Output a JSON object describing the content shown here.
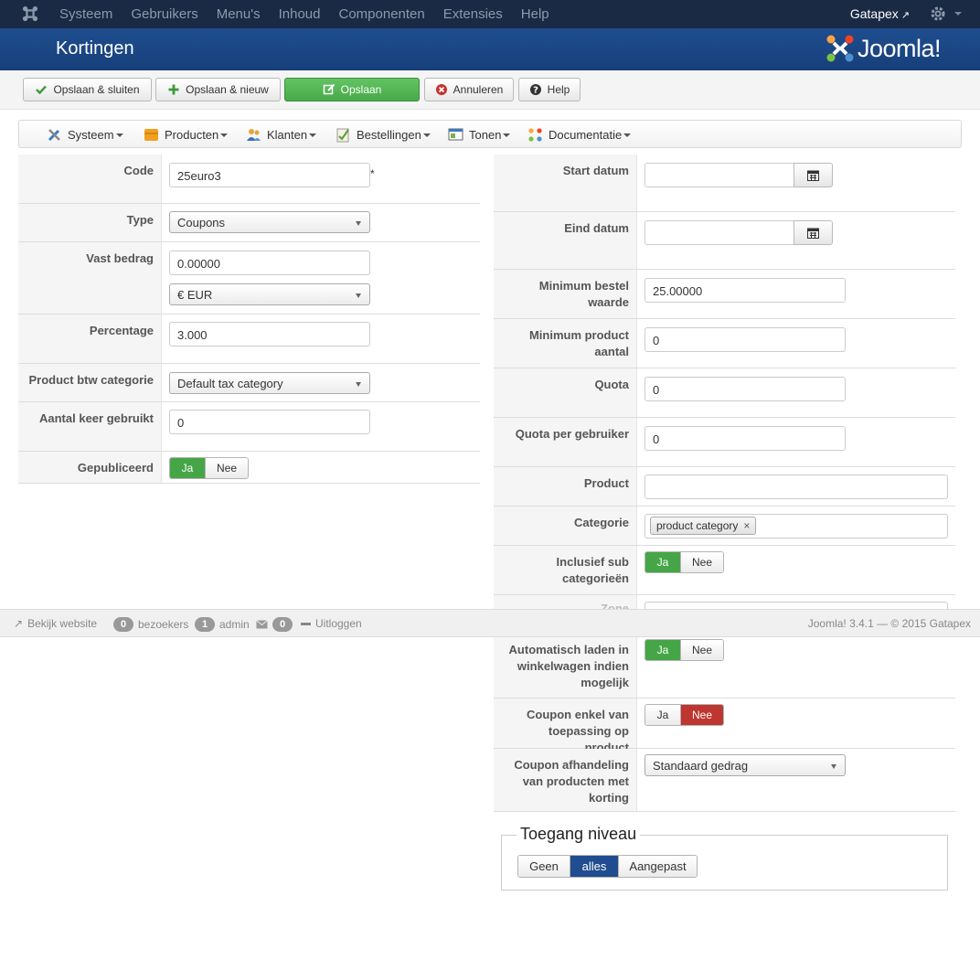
{
  "navbar": {
    "menu": [
      "Systeem",
      "Gebruikers",
      "Menu's",
      "Inhoud",
      "Componenten",
      "Extensies",
      "Help"
    ],
    "site_name": "Gatapex"
  },
  "titlebar": {
    "title": "Kortingen",
    "brand": "Joomla!"
  },
  "toolbar": {
    "save_close": "Opslaan & sluiten",
    "save_new": "Opslaan & nieuw",
    "save": "Opslaan",
    "cancel": "Annuleren",
    "help": "Help"
  },
  "component_menu": [
    "Systeem",
    "Producten",
    "Klanten",
    "Bestellingen",
    "Tonen",
    "Documentatie"
  ],
  "left": {
    "code": {
      "label": "Code",
      "value": "25euro3",
      "required_mark": "*"
    },
    "type": {
      "label": "Type",
      "value": "Coupons"
    },
    "fixed_amount": {
      "label": "Vast bedrag",
      "value": "0.00000",
      "currency": "€ EUR"
    },
    "percentage": {
      "label": "Percentage",
      "value": "3.000"
    },
    "tax_category": {
      "label": "Product btw categorie",
      "value": "Default tax category"
    },
    "times_used": {
      "label": "Aantal keer gebruikt",
      "value": "0"
    },
    "published": {
      "label": "Gepubliceerd",
      "yes": "Ja",
      "no": "Nee",
      "selected": "Ja"
    }
  },
  "right": {
    "start_date": {
      "label": "Start datum",
      "value": ""
    },
    "end_date": {
      "label": "Eind datum",
      "value": ""
    },
    "min_order": {
      "label": "Minimum bestel waarde",
      "value": "25.00000"
    },
    "min_product": {
      "label": "Minimum product aantal",
      "value": "0"
    },
    "quota": {
      "label": "Quota",
      "value": "0"
    },
    "quota_user": {
      "label": "Quota per gebruiker",
      "value": "0"
    },
    "product": {
      "label": "Product",
      "value": ""
    },
    "category": {
      "label": "Categorie",
      "tag": "product category",
      "remove": "×"
    },
    "include_sub": {
      "label": "Inclusief sub categorieën",
      "yes": "Ja",
      "no": "Nee",
      "selected": "Ja"
    },
    "zone": {
      "label": "Zone"
    },
    "auto_load": {
      "label": "Automatisch laden in winkelwagen indien mogelijk",
      "yes": "Ja",
      "no": "Nee",
      "selected": "Ja"
    },
    "coupon_product": {
      "label": "Coupon enkel van toepassing op product",
      "yes": "Ja",
      "no": "Nee",
      "selected": "Nee"
    },
    "coupon_handling": {
      "label": "Coupon afhandeling van producten met korting",
      "value": "Standaard gedrag"
    }
  },
  "access": {
    "legend": "Toegang niveau",
    "options": [
      "Geen",
      "alles",
      "Aangepast"
    ],
    "selected": "alles"
  },
  "statusbar": {
    "view_site": "Bekijk website",
    "visitors_count": "0",
    "visitors_label": "bezoekers",
    "admin_count": "1",
    "admin_label": "admin",
    "messages_count": "0",
    "logout": "Uitloggen",
    "version": "Joomla! 3.4.1 — © 2015 Gatapex"
  },
  "colors": {
    "navbar": "#1a2a44",
    "titlebar": "#1e4d8f",
    "success": "#46a546",
    "danger": "#bd362f",
    "active": "#1f4d8f"
  }
}
